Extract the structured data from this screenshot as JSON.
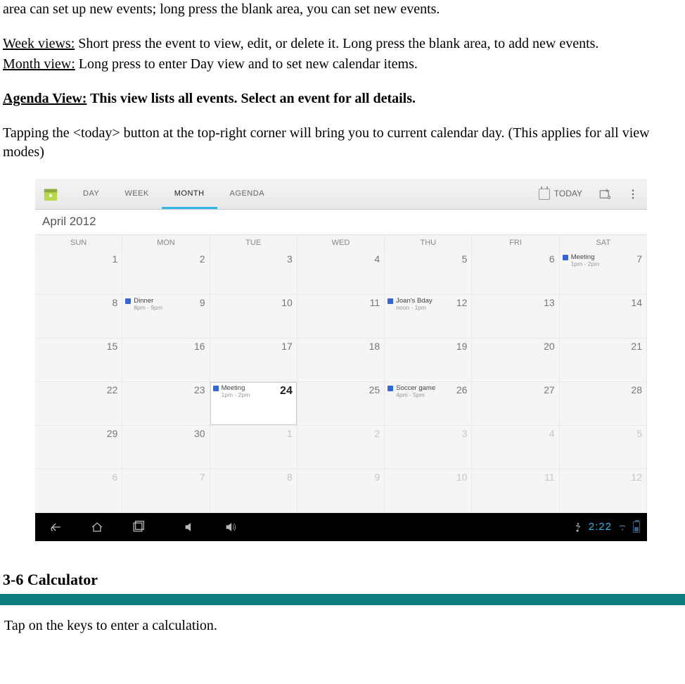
{
  "doc": {
    "line0": "area can set up new events; long press the blank area, you can set new events.",
    "week_label": "Week views:",
    "week_text": " Short press the event to view, edit, or delete it.    Long press the blank area, to add new events.",
    "month_label": "Month view:",
    "month_text": " Long press to enter Day view and to set new calendar items.",
    "agenda_label": "Agenda View:",
    "agenda_text": " This view lists all events. Select an event for all details.",
    "today_text": "Tapping the <today> button at the top-right corner will bring you to current calendar day.    (This applies for all view modes)",
    "section_calc": "3-6 Calculator",
    "calc_line": " Tap on the keys to enter a calculation."
  },
  "calendar": {
    "tabs": {
      "day": "DAY",
      "week": "WEEK",
      "month": "MONTH",
      "agenda": "AGENDA"
    },
    "today_btn": "TODAY",
    "month_title": "April 2012",
    "dow": [
      "SUN",
      "MON",
      "TUE",
      "WED",
      "THU",
      "FRI",
      "SAT"
    ],
    "weeks": [
      [
        {
          "n": "1"
        },
        {
          "n": "2"
        },
        {
          "n": "3"
        },
        {
          "n": "4"
        },
        {
          "n": "5"
        },
        {
          "n": "6"
        },
        {
          "n": "7",
          "ev": {
            "title": "Meeting",
            "time": "1pm - 2pm"
          }
        }
      ],
      [
        {
          "n": "8"
        },
        {
          "n": "9",
          "ev": {
            "title": "Dinner",
            "time": "8pm - 9pm"
          }
        },
        {
          "n": "10"
        },
        {
          "n": "11"
        },
        {
          "n": "12",
          "ev": {
            "title": "Joan's Bday",
            "time": "noon - 1pm"
          }
        },
        {
          "n": "13"
        },
        {
          "n": "14"
        }
      ],
      [
        {
          "n": "15"
        },
        {
          "n": "16"
        },
        {
          "n": "17"
        },
        {
          "n": "18"
        },
        {
          "n": "19"
        },
        {
          "n": "20"
        },
        {
          "n": "21"
        }
      ],
      [
        {
          "n": "22"
        },
        {
          "n": "23"
        },
        {
          "n": "24",
          "today": true,
          "ev": {
            "title": "Meeting",
            "time": "1pm - 2pm"
          }
        },
        {
          "n": "25"
        },
        {
          "n": "26",
          "ev": {
            "title": "Soccer game",
            "time": "4pm - 5pm"
          }
        },
        {
          "n": "27"
        },
        {
          "n": "28"
        }
      ],
      [
        {
          "n": "29"
        },
        {
          "n": "30"
        },
        {
          "n": "1",
          "other": true
        },
        {
          "n": "2",
          "other": true
        },
        {
          "n": "3",
          "other": true
        },
        {
          "n": "4",
          "other": true
        },
        {
          "n": "5",
          "other": true
        }
      ],
      [
        {
          "n": "6",
          "other": true
        },
        {
          "n": "7",
          "other": true
        },
        {
          "n": "8",
          "other": true
        },
        {
          "n": "9",
          "other": true
        },
        {
          "n": "10",
          "other": true
        },
        {
          "n": "11",
          "other": true
        },
        {
          "n": "12",
          "other": true
        }
      ]
    ],
    "status_time": "2:22"
  }
}
